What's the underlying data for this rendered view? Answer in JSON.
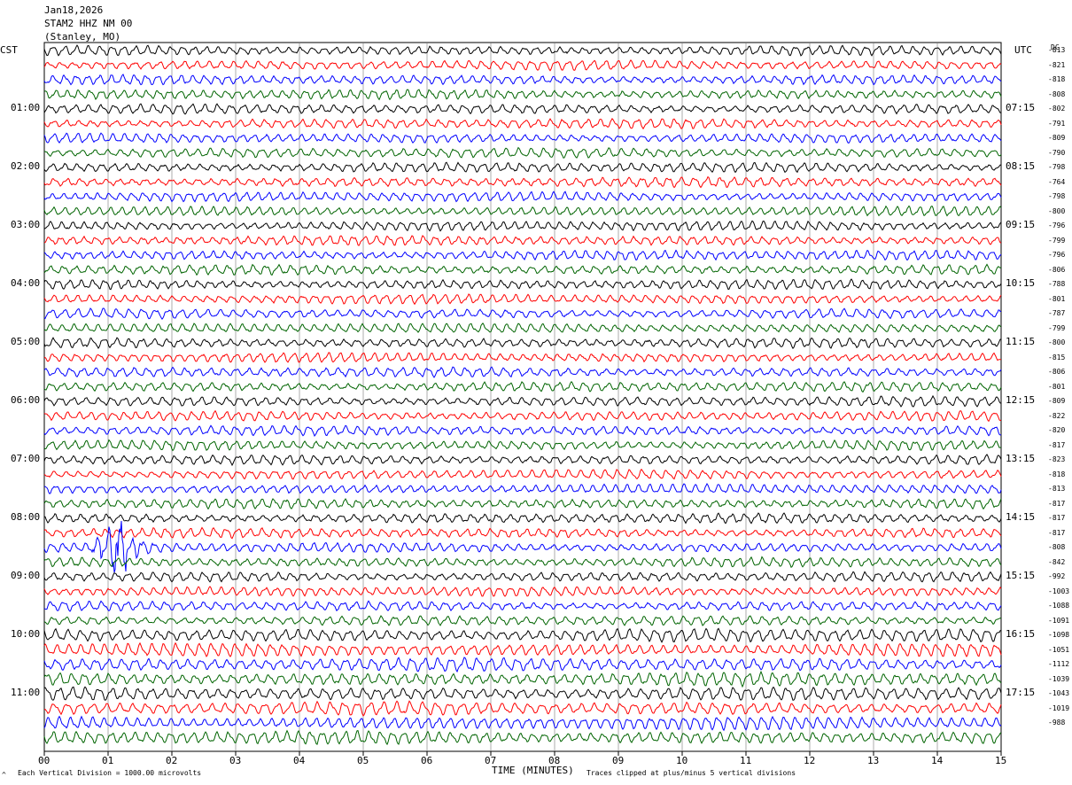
{
  "header": {
    "date": "Jan18,2026",
    "station": "STAM2 HHZ NM 00",
    "location": "(Stanley, MO)"
  },
  "axes": {
    "left_zone": "CST",
    "right_zone": "UTC",
    "dc_label": "DC",
    "x_title": "TIME (MINUTES)"
  },
  "footer": {
    "scale_note": "Each Vertical Division = 1000.00 microvolts",
    "clip_note": "Traces clipped at plus/minus 5 vertical divisions",
    "logo_mark": "^"
  },
  "chart_data": {
    "type": "line",
    "title": "",
    "xlabel": "TIME (MINUTES)",
    "xlim": [
      0,
      15
    ],
    "x_ticks": [
      "00",
      "01",
      "02",
      "03",
      "04",
      "05",
      "06",
      "07",
      "08",
      "09",
      "10",
      "11",
      "12",
      "13",
      "14",
      "15"
    ],
    "grid": true,
    "trace_colors": [
      "#000000",
      "#ff0000",
      "#0000ff",
      "#006400"
    ],
    "left_time_labels": [
      "01:00",
      "02:00",
      "03:00",
      "04:00",
      "05:00",
      "06:00",
      "07:00",
      "08:00",
      "09:00",
      "10:00",
      "11:00"
    ],
    "right_time_labels": [
      "07:15",
      "08:15",
      "09:15",
      "10:15",
      "11:15",
      "12:15",
      "13:15",
      "14:15",
      "15:15",
      "16:15",
      "17:15"
    ],
    "hour_label_trace_offset": 4,
    "trace_count": 48,
    "dc_offsets": [
      "-813",
      "-821",
      "-818",
      "-808",
      "-802",
      "-791",
      "-809",
      "-790",
      "-798",
      "-764",
      "-798",
      "-800",
      "-796",
      "-799",
      "-796",
      "-806",
      "-788",
      "-801",
      "-787",
      "-799",
      "-800",
      "-815",
      "-806",
      "-801",
      "-809",
      "-822",
      "-820",
      "-817",
      "-823",
      "-818",
      "-813",
      "-817",
      "-817",
      "-817",
      "-808",
      "-842",
      "-992",
      "-1003",
      "-1088",
      "-1091",
      "-1098",
      "-1051",
      "-1112",
      "-1039",
      "-1043",
      "-1019",
      "-988"
    ],
    "event": {
      "description_source": "visible large signal",
      "trace_index": 34,
      "start_minute": 0.75,
      "peak_minute": 1.15,
      "end_minute": 2.0
    }
  }
}
